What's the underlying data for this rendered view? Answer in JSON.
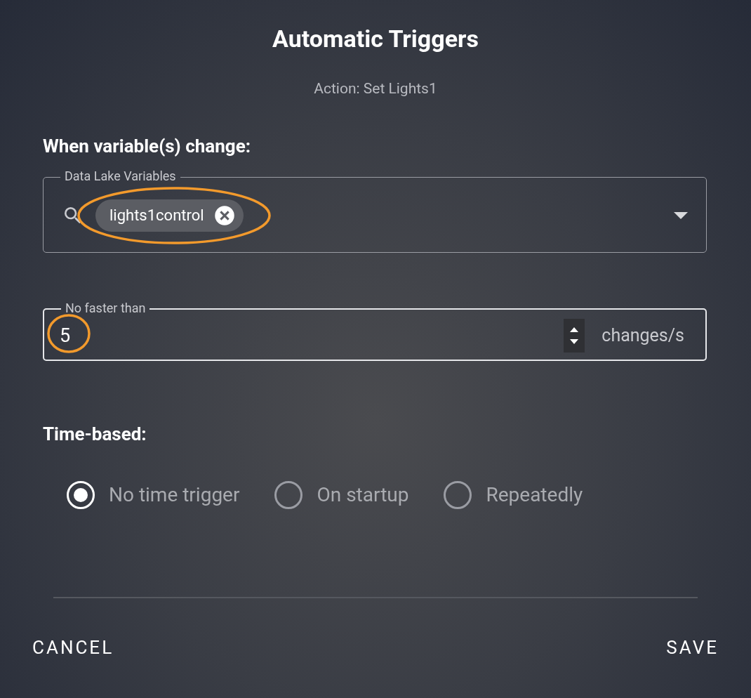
{
  "dialog": {
    "title": "Automatic Triggers",
    "subtitle": "Action: Set Lights1"
  },
  "variables_section": {
    "heading": "When variable(s) change:",
    "field": {
      "label": "Data Lake Variables",
      "chips": [
        {
          "label": "lights1control",
          "highlighted": true
        }
      ]
    }
  },
  "rate_field": {
    "label": "No faster than",
    "value": "5",
    "unit": "changes/s",
    "focused": true,
    "highlighted": true
  },
  "time_section": {
    "heading": "Time-based:",
    "options": [
      {
        "label": "No time trigger",
        "selected": true
      },
      {
        "label": "On startup",
        "selected": false
      },
      {
        "label": "Repeatedly",
        "selected": false
      }
    ]
  },
  "buttons": [
    {
      "label": "CANCEL",
      "kind": "cancel"
    },
    {
      "label": "SAVE",
      "kind": "save"
    }
  ]
}
